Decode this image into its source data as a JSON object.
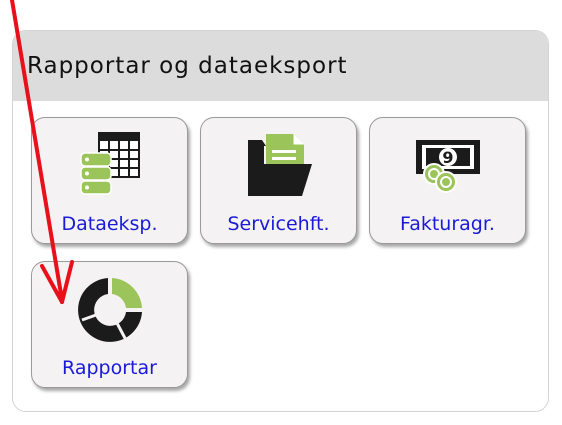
{
  "panel": {
    "title": "Rapportar og dataeksport"
  },
  "tiles": [
    {
      "label": "Dataeksp.",
      "icon": "data-export-icon"
    },
    {
      "label": "Servicehft.",
      "icon": "folder-document-icon"
    },
    {
      "label": "Fakturagr.",
      "icon": "money-coins-icon"
    },
    {
      "label": "Rapportar",
      "icon": "donut-chart-icon"
    }
  ],
  "colors": {
    "accent_green": "#9bc45b",
    "link_blue": "#1a1ad8",
    "arrow_red": "#e8101a",
    "header_bg": "#dcdcdc",
    "tile_bg": "#f4f2f2"
  }
}
